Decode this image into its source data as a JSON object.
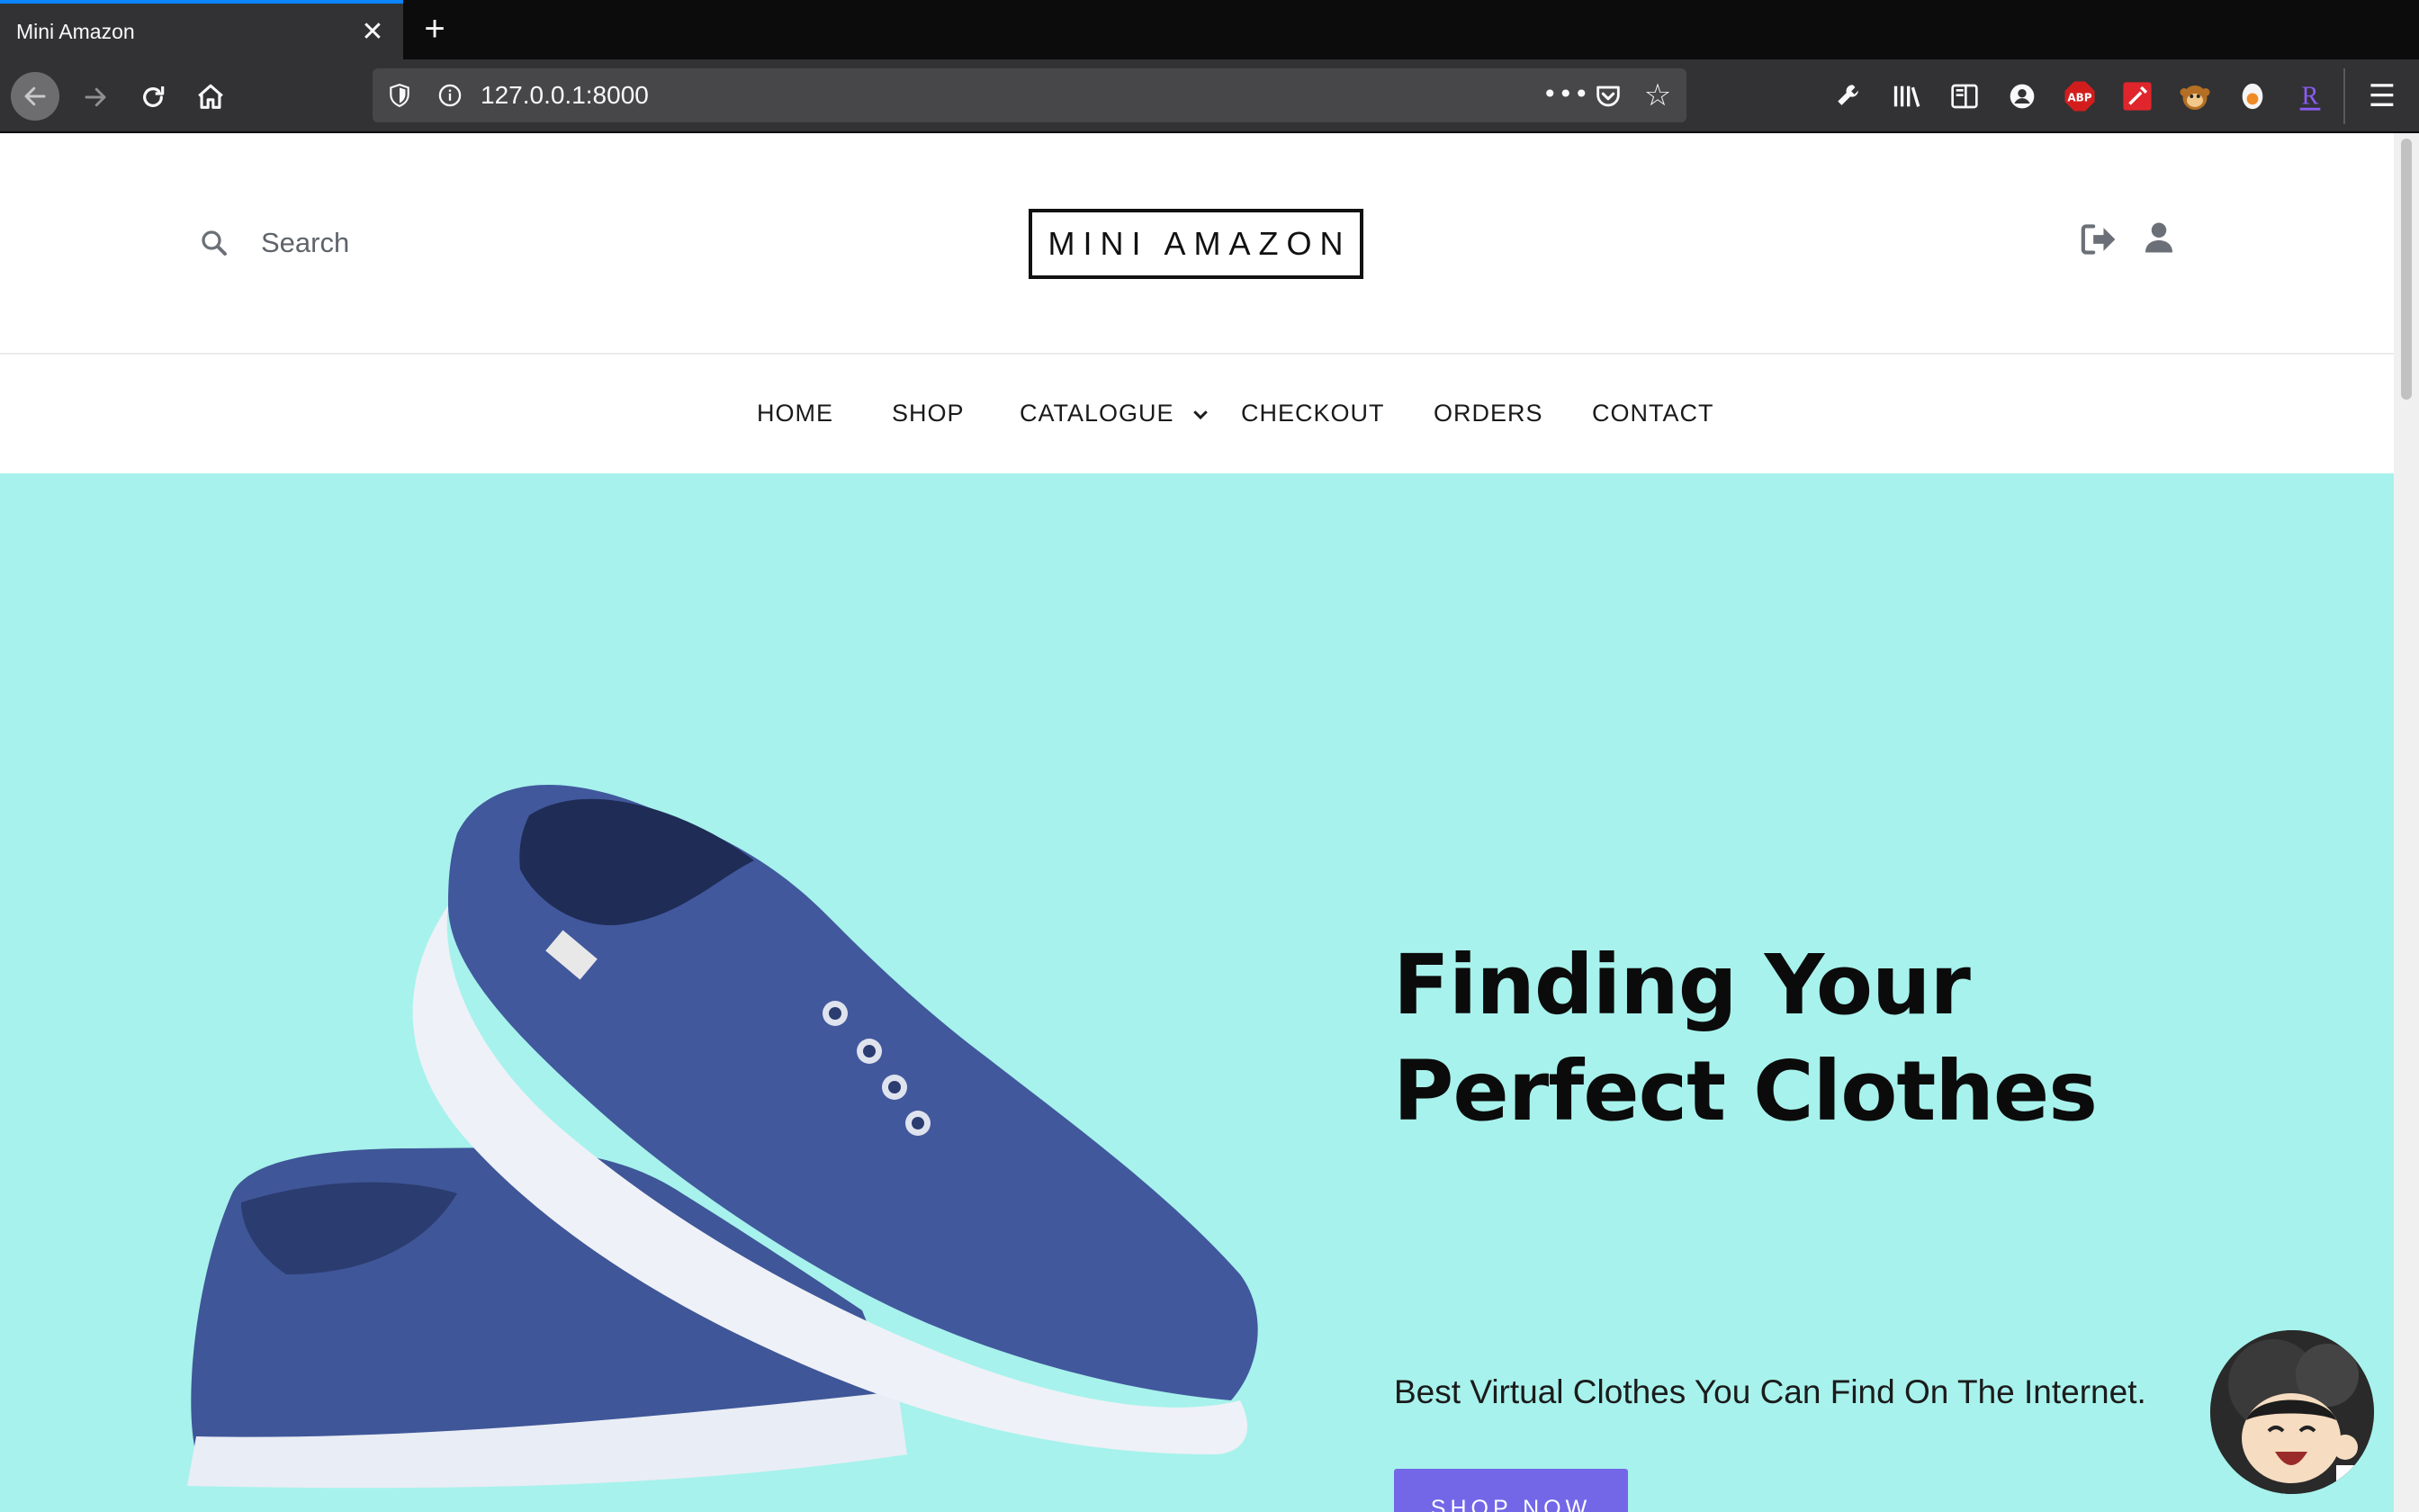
{
  "browser": {
    "tab_title": "Mini Amazon",
    "tab_close": "✕",
    "new_tab": "+",
    "url": "127.0.0.1:8000",
    "more": "•••",
    "star": "☆",
    "extensions": [
      "wrench-icon",
      "library-icon",
      "sidebar-icon",
      "account-icon",
      "adblock-plus-icon",
      "color-picker-icon",
      "tampermonkey-icon",
      "record-icon",
      "reader-icon"
    ],
    "adblock_label": "ABP",
    "r_label": "R",
    "menu": "☰"
  },
  "header": {
    "search_placeholder": "Search",
    "logo": "MINI AMAZON"
  },
  "nav": {
    "items": [
      "HOME",
      "SHOP",
      "CATALOGUE",
      "CHECKOUT",
      "ORDERS",
      "CONTACT"
    ]
  },
  "hero": {
    "title_line1": "Finding Your",
    "title_line2": "Perfect Clothes",
    "subtitle": "Best Virtual Clothes You Can Find On The Internet.",
    "cta": "SHOP NOW",
    "background": "#a7f2ec",
    "button_color": "#7367e8"
  }
}
